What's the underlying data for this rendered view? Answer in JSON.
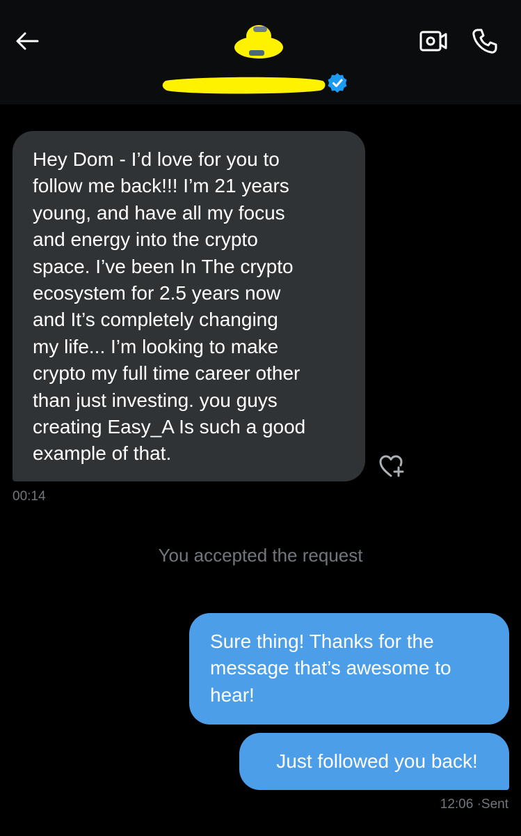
{
  "header": {
    "back_icon": "arrow-left-icon",
    "contact_name": "",
    "verified_icon": "verified-badge-icon",
    "video_icon": "video-call-icon",
    "phone_icon": "phone-icon",
    "redaction_color": "#fff200",
    "verified_color": "#1d9bf0"
  },
  "messages": [
    {
      "direction": "received",
      "text": "Hey Dom - I’d love for you to\nfollow me back!!! I’m 21 years\nyoung, and have all my focus\nand energy into the crypto\nspace. I’ve been In The crypto\necosystem for 2.5 years now\nand It’s completely changing\nmy life... I’m looking to make\ncrypto my full time career other\nthan just investing. you guys\ncreating Easy_A Is such a good\nexample of that.",
      "time": "00:14",
      "reaction_icon": "heart-plus-icon"
    },
    {
      "direction": "system",
      "text": "You accepted the request"
    },
    {
      "direction": "sent",
      "text": "Sure thing! Thanks for the\nmessage that’s awesome to\nhear!"
    },
    {
      "direction": "sent",
      "text": "Just followed you back!",
      "time": "12:06",
      "status": "Sent",
      "separator": "·"
    }
  ],
  "colors": {
    "background": "#000000",
    "header_bg": "#0b0c0e",
    "received_bubble": "#2f3336",
    "sent_bubble": "#4c9ee8",
    "muted_text": "#71767b"
  }
}
